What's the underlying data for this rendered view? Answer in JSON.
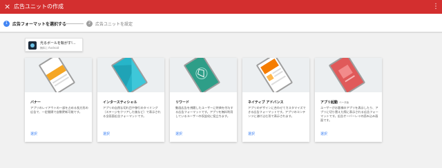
{
  "header": {
    "title": "広告ユニットの作成",
    "close_icon": "×",
    "menu_icon": "⋮"
  },
  "stepper": {
    "steps": [
      {
        "number": "1",
        "label": "広告フォーマットを選択する"
      },
      {
        "number": "2",
        "label": "広告ユニットを設定"
      }
    ]
  },
  "app": {
    "name": "光るボールを転がす!...",
    "subtitle": "無料 | Android"
  },
  "colors": {
    "header": "#d32f2f",
    "accent": "#4285f4"
  },
  "cards": [
    {
      "title": "バナー",
      "tag": "",
      "description": "アプリのレイアウトの一部を占める長方形の広告で、一定間隔で自動更新可能です。",
      "action": "選択",
      "color": "#f5a623"
    },
    {
      "title": "インタースティシャル",
      "tag": "",
      "description": "アプリの自然な切れ目や移行のタイミング（ステージをクリアした後など）で表示される全画面広告フォーマットです。",
      "action": "選択",
      "color": "#26b5c9"
    },
    {
      "title": "リワード",
      "tag": "",
      "description": "動画広告を視聴したユーザーに特典を付与する広告フォーマットです。アプリを無料利用しているユーザーの収益化に役立ちます。",
      "action": "選択",
      "color": "#2e9e88"
    },
    {
      "title": "ネイティブ アドバンス",
      "tag": "",
      "description": "アプリのデザインに合わせてカスタマイズできる広告フォーマットです。アプリのコンテンツに溶け込む形で表示されます。",
      "action": "選択",
      "color": "#f57c00"
    },
    {
      "title": "アプリ起動",
      "tag": "ベータ版",
      "description": "ユーザーがお客様のアプリを表示したり、アプリに切り替えた際に表示される広告フォーマットです。広告オーバーレイの読み込み画面です。",
      "action": "選択",
      "color": "#e05a5a"
    }
  ]
}
